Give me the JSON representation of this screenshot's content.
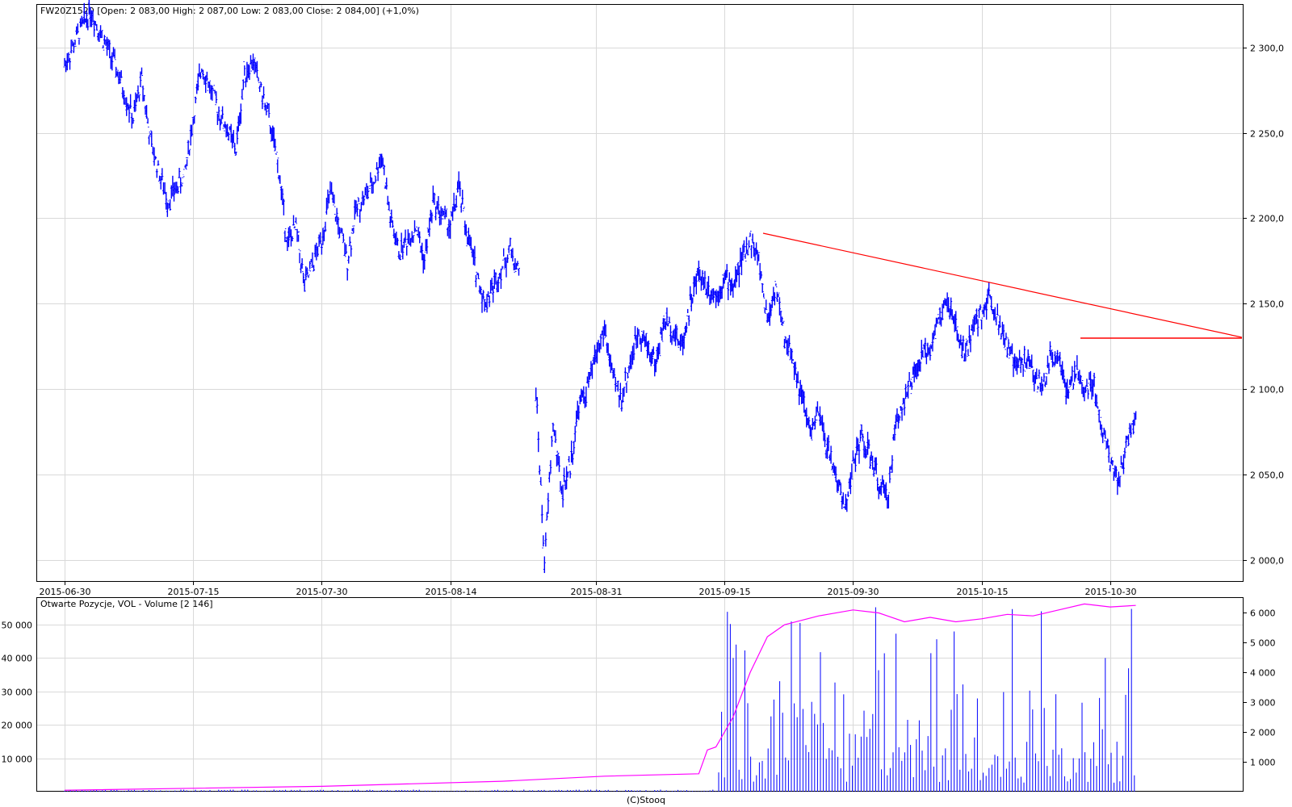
{
  "chart_data": [
    {
      "type": "ohlc",
      "title": "FW20Z1520 [Open: 2 083,00  High: 2 087,00  Low: 2 083,00  Close: 2 084,00] (+1,0%)",
      "y_ticks": [
        2000,
        2050,
        2100,
        2150,
        2200,
        2250,
        2300
      ],
      "y_tick_labels": [
        "2 000,0",
        "2 050,0",
        "2 100,0",
        "2 150,0",
        "2 200,0",
        "2 250,0",
        "2 300,0"
      ],
      "ylim": [
        1987,
        2325
      ],
      "x_tick_labels": [
        "2015-06-30",
        "2015-07-15",
        "2015-07-30",
        "2015-08-14",
        "2015-08-31",
        "2015-09-15",
        "2015-09-30",
        "2015-10-15",
        "2015-10-30"
      ],
      "price_color": "#0000ff",
      "trendline_color": "#ff0000",
      "series": [
        {
          "date": "2015-06-30",
          "value": 2290
        },
        {
          "date": "2015-07-02",
          "value": 2312
        },
        {
          "date": "2015-07-03",
          "value": 2322
        },
        {
          "date": "2015-07-06",
          "value": 2288
        },
        {
          "date": "2015-07-08",
          "value": 2258
        },
        {
          "date": "2015-07-09",
          "value": 2282
        },
        {
          "date": "2015-07-10",
          "value": 2245
        },
        {
          "date": "2015-07-12",
          "value": 2210
        },
        {
          "date": "2015-07-14",
          "value": 2225
        },
        {
          "date": "2015-07-15",
          "value": 2258
        },
        {
          "date": "2015-07-16",
          "value": 2290
        },
        {
          "date": "2015-07-18",
          "value": 2262
        },
        {
          "date": "2015-07-19",
          "value": 2252
        },
        {
          "date": "2015-07-20",
          "value": 2240
        },
        {
          "date": "2015-07-21",
          "value": 2285
        },
        {
          "date": "2015-07-22",
          "value": 2292
        },
        {
          "date": "2015-07-24",
          "value": 2255
        },
        {
          "date": "2015-07-25",
          "value": 2228
        },
        {
          "date": "2015-07-26",
          "value": 2185
        },
        {
          "date": "2015-07-27",
          "value": 2195
        },
        {
          "date": "2015-07-28",
          "value": 2160
        },
        {
          "date": "2015-07-30",
          "value": 2188
        },
        {
          "date": "2015-07-31",
          "value": 2215
        },
        {
          "date": "2015-08-02",
          "value": 2175
        },
        {
          "date": "2015-08-03",
          "value": 2205
        },
        {
          "date": "2015-08-05",
          "value": 2220
        },
        {
          "date": "2015-08-06",
          "value": 2238
        },
        {
          "date": "2015-08-07",
          "value": 2200
        },
        {
          "date": "2015-08-08",
          "value": 2180
        },
        {
          "date": "2015-08-10",
          "value": 2195
        },
        {
          "date": "2015-08-11",
          "value": 2175
        },
        {
          "date": "2015-08-12",
          "value": 2210
        },
        {
          "date": "2015-08-14",
          "value": 2195
        },
        {
          "date": "2015-08-15",
          "value": 2218
        },
        {
          "date": "2015-08-16",
          "value": 2190
        },
        {
          "date": "2015-08-17",
          "value": 2170
        },
        {
          "date": "2015-08-18",
          "value": 2150
        },
        {
          "date": "2015-08-19",
          "value": 2160
        },
        {
          "date": "2015-08-21",
          "value": 2182
        },
        {
          "date": "2015-08-22",
          "value": 2168
        },
        {
          "date": "2015-08-24",
          "value": 2100
        },
        {
          "date": "2015-08-25",
          "value": 1998
        },
        {
          "date": "2015-08-26",
          "value": 2080
        },
        {
          "date": "2015-08-27",
          "value": 2040
        },
        {
          "date": "2015-08-28",
          "value": 2055
        },
        {
          "date": "2015-08-29",
          "value": 2090
        },
        {
          "date": "2015-08-30",
          "value": 2100
        },
        {
          "date": "2015-08-31",
          "value": 2120
        },
        {
          "date": "2015-09-01",
          "value": 2135
        },
        {
          "date": "2015-09-02",
          "value": 2105
        },
        {
          "date": "2015-09-03",
          "value": 2095
        },
        {
          "date": "2015-09-04",
          "value": 2115
        },
        {
          "date": "2015-09-05",
          "value": 2135
        },
        {
          "date": "2015-09-06",
          "value": 2125
        },
        {
          "date": "2015-09-07",
          "value": 2115
        },
        {
          "date": "2015-09-08",
          "value": 2140
        },
        {
          "date": "2015-09-09",
          "value": 2135
        },
        {
          "date": "2015-09-10",
          "value": 2125
        },
        {
          "date": "2015-09-11",
          "value": 2150
        },
        {
          "date": "2015-09-12",
          "value": 2168
        },
        {
          "date": "2015-09-13",
          "value": 2160
        },
        {
          "date": "2015-09-14",
          "value": 2155
        },
        {
          "date": "2015-09-15",
          "value": 2165
        },
        {
          "date": "2015-09-16",
          "value": 2160
        },
        {
          "date": "2015-09-17",
          "value": 2175
        },
        {
          "date": "2015-09-18",
          "value": 2188
        },
        {
          "date": "2015-09-19",
          "value": 2175
        },
        {
          "date": "2015-09-20",
          "value": 2140
        },
        {
          "date": "2015-09-21",
          "value": 2160
        },
        {
          "date": "2015-09-22",
          "value": 2130
        },
        {
          "date": "2015-09-23",
          "value": 2118
        },
        {
          "date": "2015-09-24",
          "value": 2095
        },
        {
          "date": "2015-09-25",
          "value": 2075
        },
        {
          "date": "2015-09-26",
          "value": 2085
        },
        {
          "date": "2015-09-27",
          "value": 2065
        },
        {
          "date": "2015-09-28",
          "value": 2050
        },
        {
          "date": "2015-09-29",
          "value": 2030
        },
        {
          "date": "2015-09-30",
          "value": 2055
        },
        {
          "date": "2015-10-01",
          "value": 2072
        },
        {
          "date": "2015-10-02",
          "value": 2060
        },
        {
          "date": "2015-10-03",
          "value": 2045
        },
        {
          "date": "2015-10-04",
          "value": 2035
        },
        {
          "date": "2015-10-05",
          "value": 2080
        },
        {
          "date": "2015-10-06",
          "value": 2095
        },
        {
          "date": "2015-10-07",
          "value": 2105
        },
        {
          "date": "2015-10-08",
          "value": 2118
        },
        {
          "date": "2015-10-09",
          "value": 2125
        },
        {
          "date": "2015-10-10",
          "value": 2140
        },
        {
          "date": "2015-10-11",
          "value": 2152
        },
        {
          "date": "2015-10-12",
          "value": 2135
        },
        {
          "date": "2015-10-13",
          "value": 2120
        },
        {
          "date": "2015-10-14",
          "value": 2135
        },
        {
          "date": "2015-10-15",
          "value": 2145
        },
        {
          "date": "2015-10-16",
          "value": 2155
        },
        {
          "date": "2015-10-17",
          "value": 2140
        },
        {
          "date": "2015-10-18",
          "value": 2125
        },
        {
          "date": "2015-10-19",
          "value": 2112
        },
        {
          "date": "2015-10-20",
          "value": 2118
        },
        {
          "date": "2015-10-21",
          "value": 2110
        },
        {
          "date": "2015-10-22",
          "value": 2100
        },
        {
          "date": "2015-10-23",
          "value": 2118
        },
        {
          "date": "2015-10-24",
          "value": 2122
        },
        {
          "date": "2015-10-25",
          "value": 2095
        },
        {
          "date": "2015-10-26",
          "value": 2110
        },
        {
          "date": "2015-10-27",
          "value": 2100
        },
        {
          "date": "2015-10-28",
          "value": 2105
        },
        {
          "date": "2015-10-29",
          "value": 2078
        },
        {
          "date": "2015-10-30",
          "value": 2060
        },
        {
          "date": "2015-10-31",
          "value": 2045
        },
        {
          "date": "2015-11-01",
          "value": 2070
        },
        {
          "date": "2015-11-02",
          "value": 2084
        }
      ]
    },
    {
      "type": "bar",
      "title": "Otwarte Pozycje, VOL - Volume [2 146]",
      "left_ticks": [
        10000,
        20000,
        30000,
        40000,
        50000
      ],
      "left_tick_labels": [
        "10 000",
        "20 000",
        "30 000",
        "40 000",
        "50 000"
      ],
      "right_ticks": [
        1000,
        2000,
        3000,
        4000,
        5000,
        6000
      ],
      "right_tick_labels": [
        "1 000",
        "2 000",
        "3 000",
        "4 000",
        "5 000",
        "6 000"
      ],
      "left_ylim": [
        0,
        58000
      ],
      "right_ylim": [
        0,
        6500
      ],
      "volume_color": "#0000ff",
      "open_interest_color": "#ff00ff",
      "open_interest": [
        {
          "date": "2015-06-30",
          "value": 50
        },
        {
          "date": "2015-07-30",
          "value": 180
        },
        {
          "date": "2015-08-20",
          "value": 350
        },
        {
          "date": "2015-09-01",
          "value": 520
        },
        {
          "date": "2015-09-12",
          "value": 600
        },
        {
          "date": "2015-09-13",
          "value": 1400
        },
        {
          "date": "2015-09-14",
          "value": 1500
        },
        {
          "date": "2015-09-16",
          "value": 2500
        },
        {
          "date": "2015-09-18",
          "value": 4000
        },
        {
          "date": "2015-09-20",
          "value": 5200
        },
        {
          "date": "2015-09-22",
          "value": 5600
        },
        {
          "date": "2015-09-26",
          "value": 5900
        },
        {
          "date": "2015-09-30",
          "value": 6100
        },
        {
          "date": "2015-10-03",
          "value": 6000
        },
        {
          "date": "2015-10-06",
          "value": 5700
        },
        {
          "date": "2015-10-09",
          "value": 5850
        },
        {
          "date": "2015-10-12",
          "value": 5700
        },
        {
          "date": "2015-10-15",
          "value": 5800
        },
        {
          "date": "2015-10-18",
          "value": 5950
        },
        {
          "date": "2015-10-21",
          "value": 5900
        },
        {
          "date": "2015-10-24",
          "value": 6100
        },
        {
          "date": "2015-10-27",
          "value": 6300
        },
        {
          "date": "2015-10-30",
          "value": 6200
        },
        {
          "date": "2015-11-02",
          "value": 6250
        }
      ]
    }
  ],
  "footer": {
    "credit": "(C)Stooq"
  }
}
